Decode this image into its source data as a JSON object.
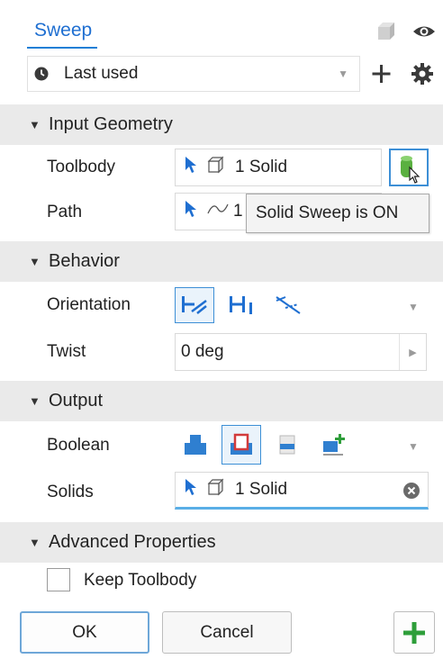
{
  "header": {
    "tab_label": "Sweep",
    "preset_value": "Last used"
  },
  "sections": {
    "input_geometry": "Input Geometry",
    "behavior": "Behavior",
    "output": "Output",
    "advanced": "Advanced Properties"
  },
  "input_geometry": {
    "toolbody_label": "Toolbody",
    "toolbody_value": "1 Solid",
    "path_label": "Path",
    "path_value": "1"
  },
  "tooltip": {
    "text": "Solid Sweep is ON"
  },
  "behavior": {
    "orientation_label": "Orientation",
    "twist_label": "Twist",
    "twist_value": "0 deg"
  },
  "output": {
    "boolean_label": "Boolean",
    "solids_label": "Solids",
    "solids_value": "1 Solid"
  },
  "advanced": {
    "keep_toolbody_label": "Keep Toolbody"
  },
  "buttons": {
    "ok": "OK",
    "cancel": "Cancel"
  },
  "colors": {
    "accent_blue": "#1f6fd1",
    "section_bg": "#eaeaea",
    "add_green": "#2e9e3a",
    "boolean_blue": "#2f7fd0",
    "boolean_red": "#d23b3b"
  }
}
